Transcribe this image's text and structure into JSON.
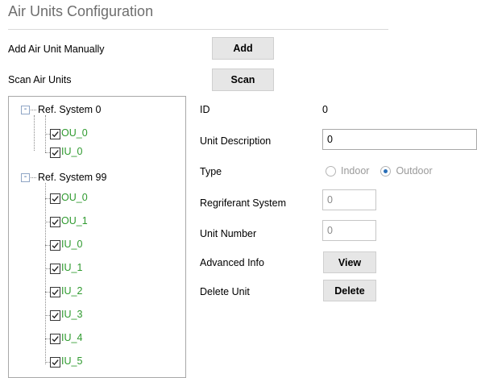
{
  "header": {
    "title": "Air Units Configuration"
  },
  "actions": {
    "add_label": "Add Air Unit Manually",
    "add_button": "Add",
    "scan_label": "Scan Air Units",
    "scan_button": "Scan"
  },
  "tree": {
    "expander_symbol": "-",
    "systems": [
      {
        "name": "Ref. System 0",
        "children": [
          "OU_0",
          "IU_0"
        ]
      },
      {
        "name": "Ref. System 99",
        "children": [
          "OU_0",
          "OU_1",
          "IU_0",
          "IU_1",
          "IU_2",
          "IU_3",
          "IU_4",
          "IU_5"
        ]
      }
    ]
  },
  "details": {
    "id_label": "ID",
    "id_value": "0",
    "desc_label": "Unit Description",
    "desc_value": "0",
    "type_label": "Type",
    "type_options": [
      "Indoor",
      "Outdoor"
    ],
    "type_selected": "Outdoor",
    "refsys_label": "Regriferant System",
    "refsys_value": "0",
    "unitnum_label": "Unit Number",
    "unitnum_value": "0",
    "adv_label": "Advanced Info",
    "view_button": "View",
    "delete_label": "Delete Unit",
    "delete_button": "Delete"
  },
  "colors": {
    "child_text": "#2e9a2e",
    "radio_selected": "#2a6fb8",
    "header_text": "#6e6e6e"
  }
}
